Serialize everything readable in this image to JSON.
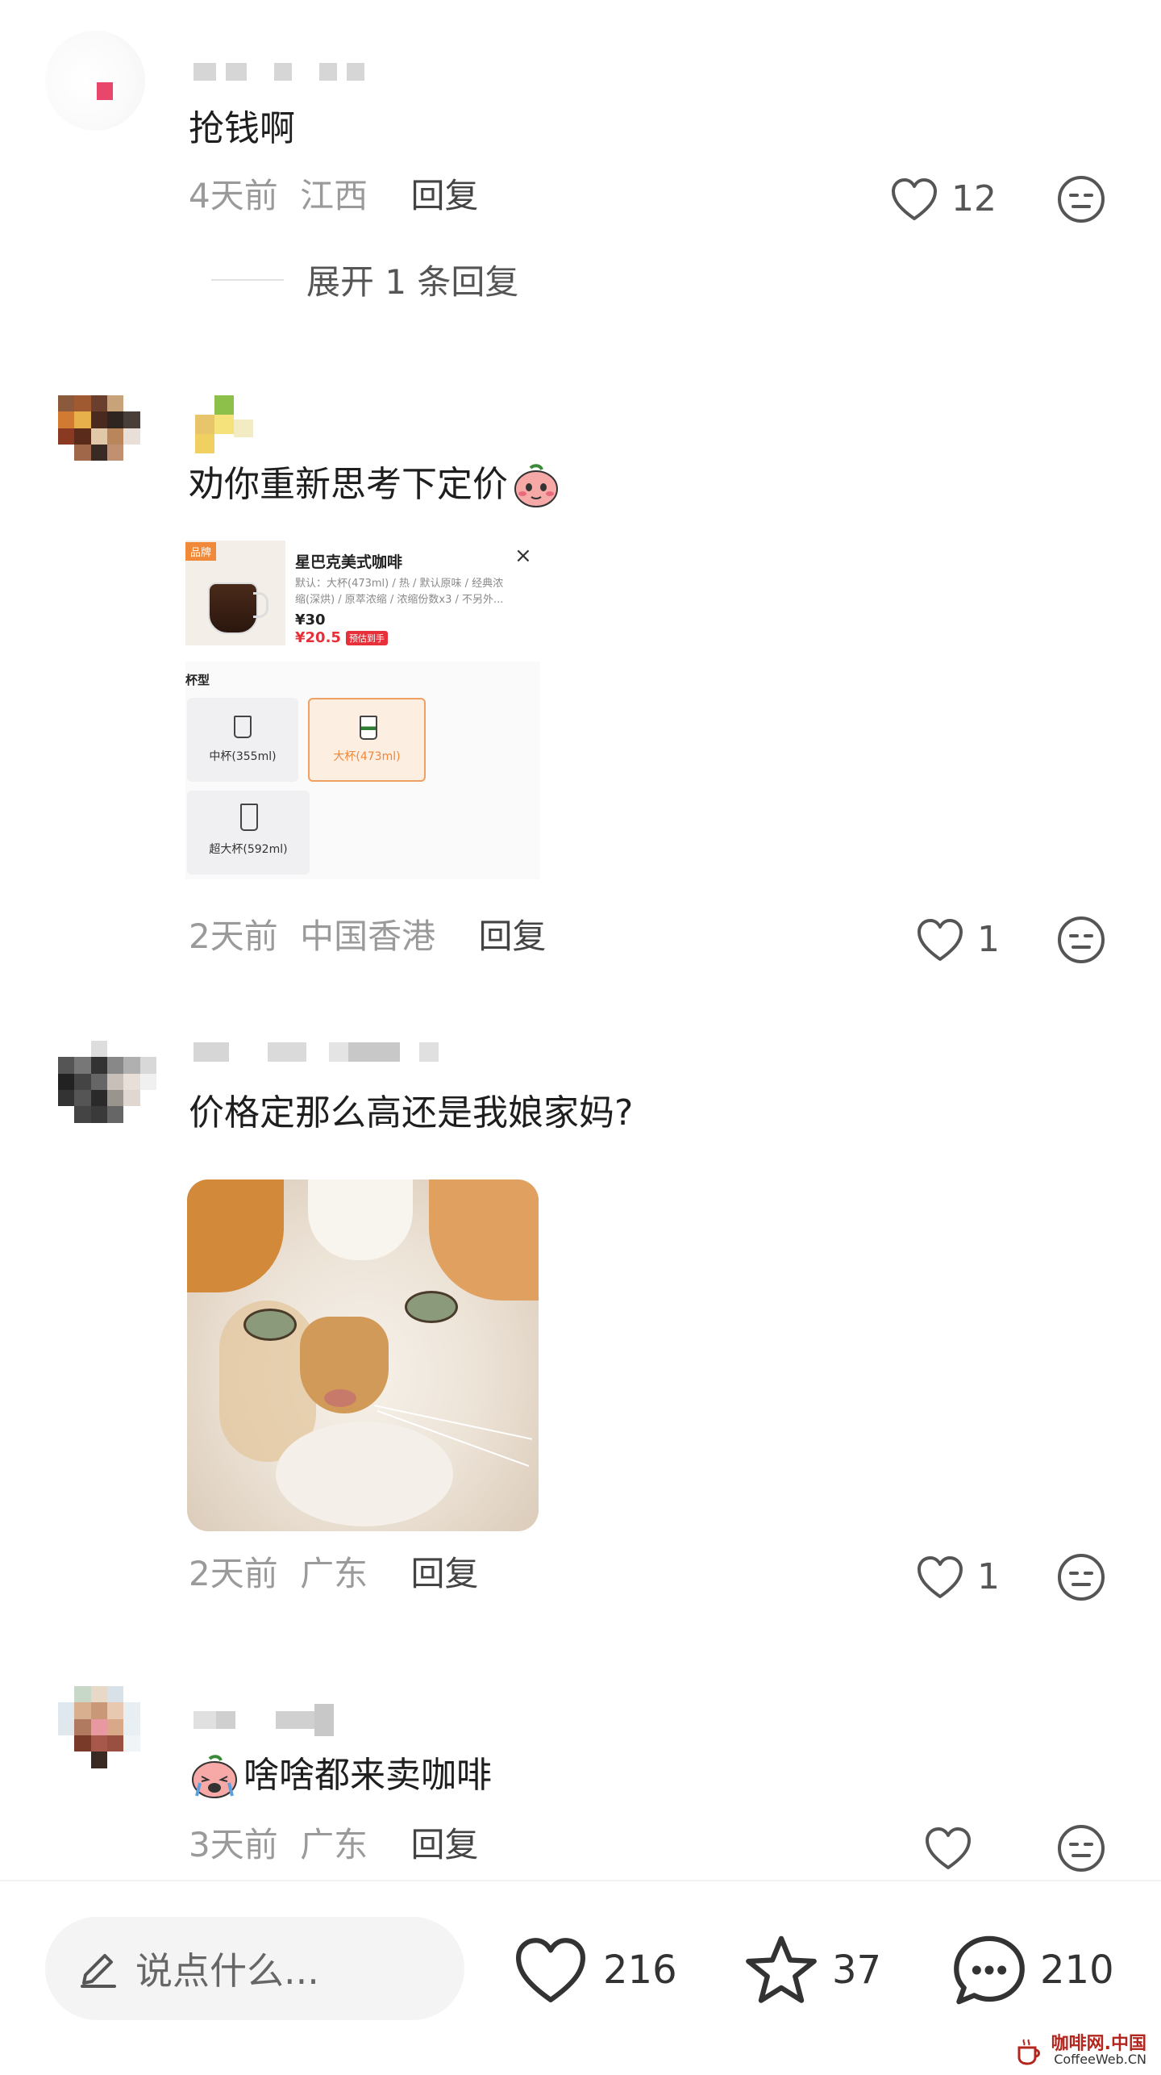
{
  "comments": [
    {
      "text": "抢钱啊",
      "time": "4天前",
      "location": "江西",
      "reply": "回复",
      "likes": "12",
      "expand": "展开 1 条回复"
    },
    {
      "text": "劝你重新思考下定价",
      "time": "2天前",
      "location": "中国香港",
      "reply": "回复",
      "likes": "1",
      "card": {
        "product_name": "星巴克美式咖啡",
        "badge": "品牌",
        "desc_line1": "默认：大杯(473ml) / 热 / 默认原味 / 经典浓",
        "desc_line2": "缩(深烘) / 原萃浓缩 / 浓缩份数x3 / 不另外...",
        "price_original": "¥30",
        "price_deal": "¥20.5",
        "deal_tag": "预估到手",
        "size_label": "杯型",
        "sizes": [
          "中杯(355ml)",
          "大杯(473ml)",
          "超大杯(592ml)"
        ],
        "close": "×"
      }
    },
    {
      "text": "价格定那么高还是我娘家妈?",
      "time": "2天前",
      "location": "广东",
      "reply": "回复",
      "likes": "1"
    },
    {
      "text": "啥啥都来卖咖啡",
      "time": "3天前",
      "location": "广东",
      "reply": "回复",
      "likes": ""
    }
  ],
  "bottom_bar": {
    "placeholder": "说点什么...",
    "likes": "216",
    "favorites": "37",
    "comments": "210"
  },
  "watermark": {
    "cn": "咖啡网.中国",
    "en": "CoffeeWeb.CN"
  },
  "colors": {
    "accent_orange": "#f0873a",
    "price_red": "#e8303a",
    "meta_gray": "#9a9a9a"
  }
}
